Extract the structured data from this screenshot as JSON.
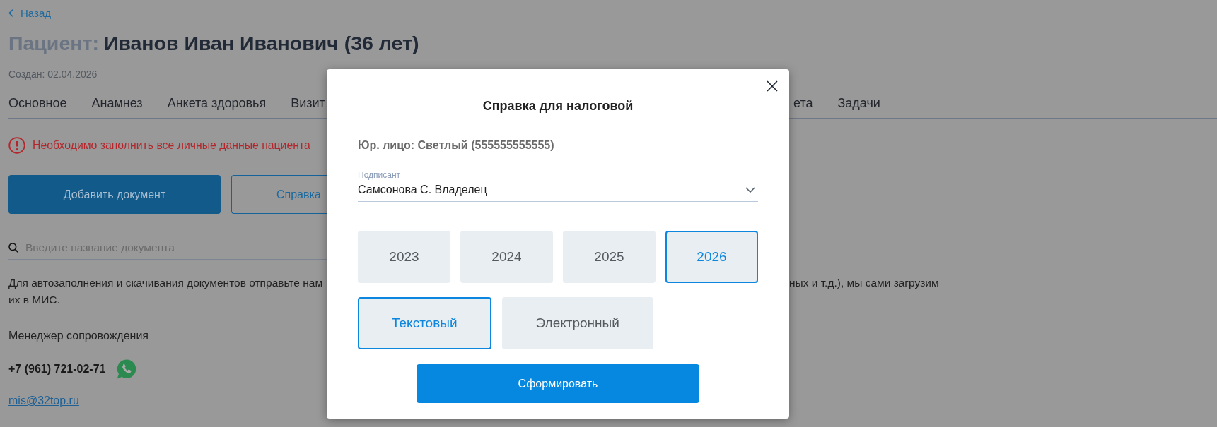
{
  "back_link": {
    "label": "Назад"
  },
  "header": {
    "prefix": "Пациент:",
    "patient": "Иванов Иван Иванович (36 лет)",
    "created": "Создан: 02.04.2026"
  },
  "tabs": {
    "left_of_dialog": [
      {
        "label": "Основное",
        "selected": false
      },
      {
        "label": "Анамнез",
        "selected": false
      },
      {
        "label": "Анкета здоровья",
        "selected": false
      },
      {
        "label": "Визит",
        "selected": false
      }
    ],
    "right_of_dialog": [
      {
        "label": "ета",
        "selected": false
      },
      {
        "label": "Задачи",
        "selected": false
      }
    ]
  },
  "alert": {
    "text": "Необходимо заполнить все личные данные пациента"
  },
  "actions": [
    {
      "label": "Добавить документ",
      "kind": "primary"
    },
    {
      "label": "Справка",
      "kind": "outline"
    }
  ],
  "search": {
    "placeholder": "Введите название документа"
  },
  "info_text": {
    "line_1_left": "Для автозаполнения и скачивания документов отправьте нам",
    "line_1_right": "ных и т.д.), мы сами загрузим",
    "line_2": "их в МИС."
  },
  "manager": {
    "title": "Менеджер сопровождения",
    "phone": "+7 (961) 721-02-71",
    "email": "mis@32top.ru"
  },
  "dialog": {
    "title": "Справка для налоговой",
    "legal_entity": "Юр. лицо: Светлый (555555555555)",
    "signer": {
      "label": "Подписант",
      "value": "Самсонова С. Владелец"
    },
    "years": [
      {
        "label": "2023",
        "selected": false
      },
      {
        "label": "2024",
        "selected": false
      },
      {
        "label": "2025",
        "selected": false
      },
      {
        "label": "2026",
        "selected": true
      }
    ],
    "formats": [
      {
        "label": "Текстовый",
        "selected": true
      },
      {
        "label": "Электронный",
        "selected": false
      }
    ],
    "submit": "Сформировать"
  }
}
